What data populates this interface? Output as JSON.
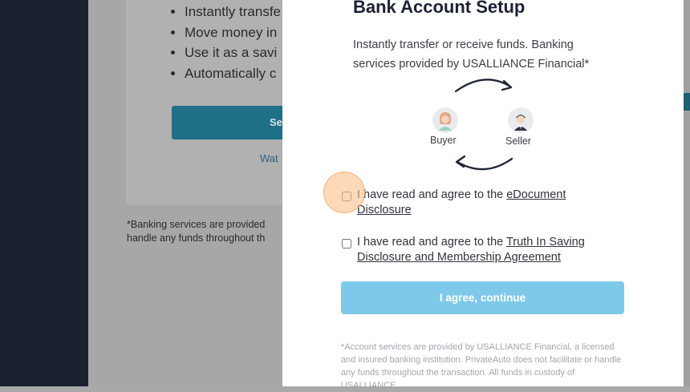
{
  "background": {
    "bullets": [
      "Instantly transfe",
      "Move money in",
      "Use it as a savi",
      "Automatically c"
    ],
    "button_label": "Se",
    "link_text": "Wat",
    "note_line1": "*Banking services are provided",
    "note_line2": "handle any funds throughout th"
  },
  "modal": {
    "title": "Bank Account Setup",
    "intro": "Instantly transfer or receive funds. Banking services provided by USALLIANCE Financial*",
    "diagram": {
      "buyer_label": "Buyer",
      "seller_label": "Seller"
    },
    "consent1": {
      "prefix": "I have read and agree to the ",
      "link": "eDocument Disclosure",
      "checked": false
    },
    "consent2": {
      "prefix": "I have read and agree to the ",
      "link": "Truth In Saving Disclosure and Membership Agreement",
      "checked": false
    },
    "agree_button": "I agree, continue",
    "fine_print": "*Account services are provided by USALLIANCE Financial, a licensed and insured banking institution. PrivateAuto does not facilitate or handle any funds throughout the transaction. All funds in custody of USALLIANCE"
  },
  "colors": {
    "accent": "#7ec9ea",
    "sidebar": "#1b2030",
    "cursor": "#fbbe87"
  },
  "icons": [
    "arrow-clockwise-icon",
    "buyer-avatar-icon",
    "seller-avatar-icon"
  ]
}
